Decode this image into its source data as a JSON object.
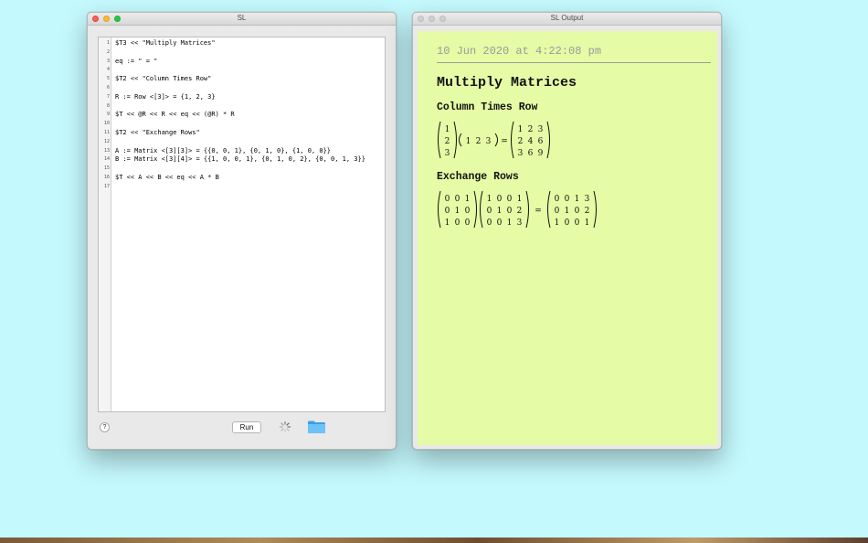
{
  "editor_window": {
    "title": "SL",
    "lines": [
      {
        "n": "1",
        "code": "$T3 << \"Multiply Matrices\""
      },
      {
        "n": "2",
        "code": ""
      },
      {
        "n": "3",
        "code": "eq := \" = \""
      },
      {
        "n": "4",
        "code": ""
      },
      {
        "n": "5",
        "code": "$T2 << \"Column Times Row\""
      },
      {
        "n": "6",
        "code": ""
      },
      {
        "n": "7",
        "code": "R := Row <[3]> = {1, 2, 3}"
      },
      {
        "n": "8",
        "code": ""
      },
      {
        "n": "9",
        "code": "$T << @R << R << eq << (@R) * R"
      },
      {
        "n": "10",
        "code": ""
      },
      {
        "n": "11",
        "code": "$T2 << \"Exchange Rows\""
      },
      {
        "n": "12",
        "code": ""
      },
      {
        "n": "13",
        "code": "A := Matrix <[3][3]> = {{0, 0, 1}, {0, 1, 0}, {1, 0, 0}}"
      },
      {
        "n": "14",
        "code": "B := Matrix <[3][4]> = {{1, 0, 0, 1}, {0, 1, 0, 2}, {0, 0, 1, 3}}"
      },
      {
        "n": "15",
        "code": ""
      },
      {
        "n": "16",
        "code": "$T << A << B << eq << A * B"
      },
      {
        "n": "17",
        "code": ""
      }
    ],
    "help_label": "?",
    "run_label": "Run",
    "icons": {
      "help": "help-icon",
      "spinner": "progress-spinner-icon",
      "folder": "folder-icon"
    }
  },
  "output_window": {
    "title": "SL Output",
    "timestamp": "10 Jun 2020 at 4:22:08 pm",
    "heading": "Multiply Matrices",
    "section1": {
      "title": "Column Times Row",
      "column": [
        [
          "1"
        ],
        [
          "2"
        ],
        [
          "3"
        ]
      ],
      "row": [
        [
          "1",
          "2",
          "3"
        ]
      ],
      "eq": "=",
      "result": [
        [
          "1",
          "2",
          "3"
        ],
        [
          "2",
          "4",
          "6"
        ],
        [
          "3",
          "6",
          "9"
        ]
      ]
    },
    "section2": {
      "title": "Exchange Rows",
      "A": [
        [
          "0",
          "0",
          "1"
        ],
        [
          "0",
          "1",
          "0"
        ],
        [
          "1",
          "0",
          "0"
        ]
      ],
      "B": [
        [
          "1",
          "0",
          "0",
          "1"
        ],
        [
          "0",
          "1",
          "0",
          "2"
        ],
        [
          "0",
          "0",
          "1",
          "3"
        ]
      ],
      "eq": "=",
      "result": [
        [
          "0",
          "0",
          "1",
          "3"
        ],
        [
          "0",
          "1",
          "0",
          "2"
        ],
        [
          "1",
          "0",
          "0",
          "1"
        ]
      ]
    }
  },
  "colors": {
    "desktop": "#c4f9fd",
    "output_background": "#e5fba5",
    "timestamp_text": "#9a9a9a"
  }
}
